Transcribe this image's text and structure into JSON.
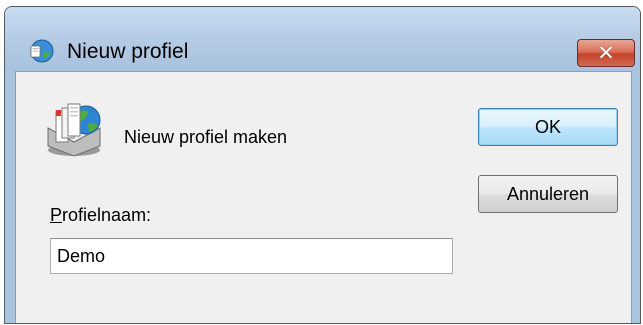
{
  "window": {
    "title": "Nieuw profiel",
    "close_glyph": "✕",
    "title_icon": "profile-globe-icon"
  },
  "dialog": {
    "heading": "Nieuw profiel maken",
    "app_icon": "mail-profile-icon",
    "field_label_accel": "P",
    "field_label_rest": "rofielnaam:",
    "field_value": "Demo",
    "ok_label": "OK",
    "cancel_label": "Annuleren"
  },
  "colors": {
    "titlebar": "#b6cde6",
    "client": "#f0f0f0",
    "close_button": "#c4432c",
    "default_button_border": "#3c7fb1"
  }
}
